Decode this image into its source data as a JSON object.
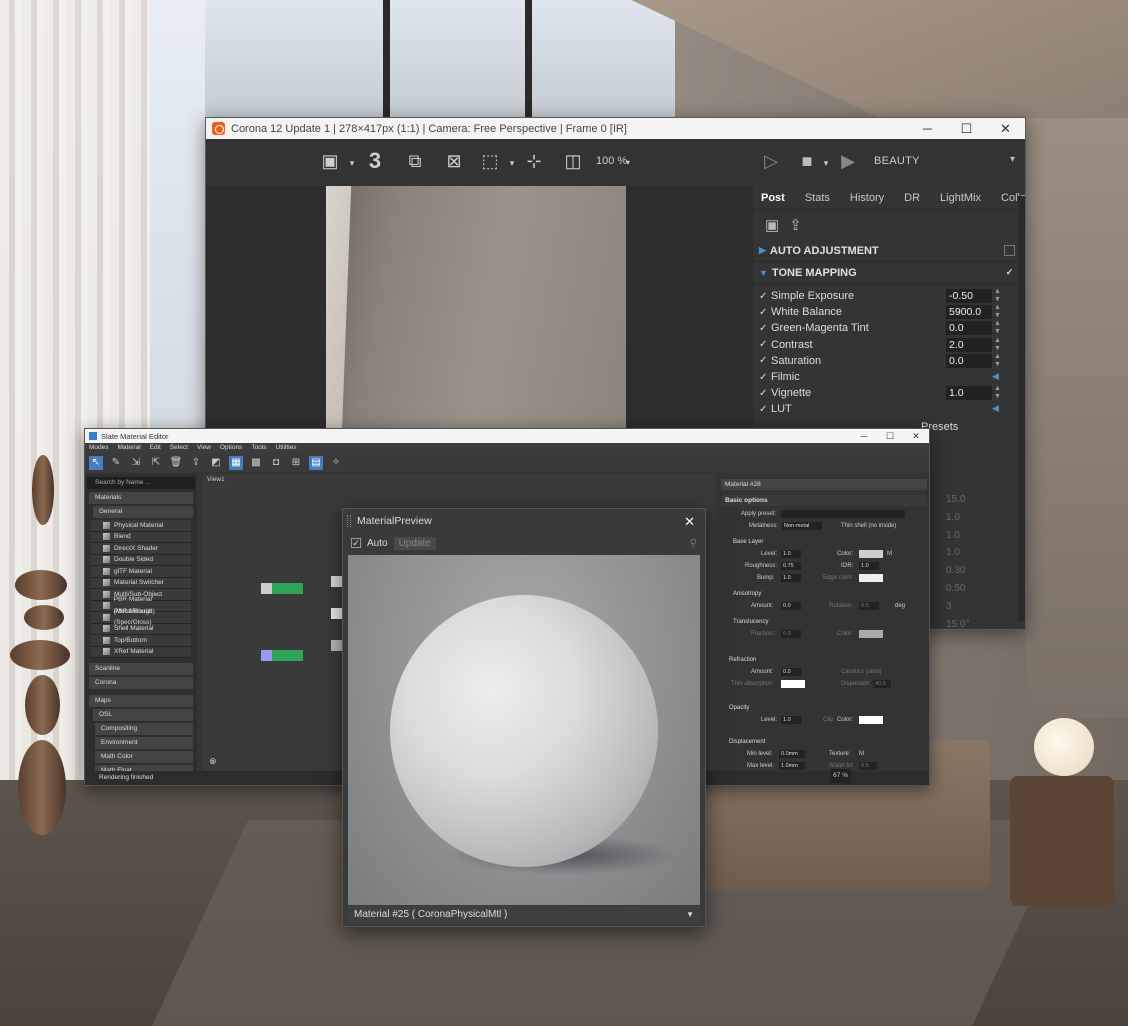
{
  "corona": {
    "title": "Corona 12 Update 1 | 278×417px (1:1) | Camera: Free Perspective | Frame 0 [IR]",
    "toolbar": {
      "frame_number": "3",
      "zoom": "100 %",
      "render_pass": "BEAUTY"
    },
    "tabs": [
      "Post",
      "Stats",
      "History",
      "DR",
      "LightMix",
      "Collab"
    ],
    "sections": {
      "auto_adjustment": "AUTO ADJUSTMENT",
      "tone_mapping": "TONE MAPPING"
    },
    "tone_mapping": [
      {
        "label": "Simple Exposure",
        "value": "-0.50"
      },
      {
        "label": "White Balance",
        "value": "5900.0"
      },
      {
        "label": "Green-Magenta Tint",
        "value": "0.0"
      },
      {
        "label": "Contrast",
        "value": "2.0"
      },
      {
        "label": "Saturation",
        "value": "0.0"
      },
      {
        "label": "Filmic",
        "value": ""
      },
      {
        "label": "Vignette",
        "value": "1.0"
      },
      {
        "label": "LUT",
        "value": ""
      }
    ],
    "presets_label": "Presets",
    "hidden_values": [
      "15.0",
      "1.0",
      "1.0",
      "1.0",
      "0.30",
      "0.50",
      "3",
      "15.0°"
    ]
  },
  "slate": {
    "title": "Slate Material Editor",
    "menu": [
      "Modes",
      "Material",
      "Edit",
      "Select",
      "View",
      "Options",
      "Tools",
      "Utilities"
    ],
    "search_placeholder": "Search by Name ...",
    "materials_group": "Materials",
    "general_group": "General",
    "materials": [
      "Physical Material",
      "Blend",
      "DirectX Shader",
      "Double Sided",
      "glTF Material",
      "Material Switcher",
      "Multi/Sub-Object",
      "PBR Material (Metal/Rough)",
      "PBR Material (Spec/Gloss)",
      "Shell Material",
      "Top/Bottom",
      "XRef Material"
    ],
    "groups": [
      "Scanline",
      "Corona"
    ],
    "maps_group": "Maps",
    "osl_group": "OSL",
    "map_groups": [
      "Compositing",
      "Environment",
      "Math Color",
      "Math Float"
    ],
    "view_label": "View1",
    "panel_title": "Material #28",
    "basic_options": "Basic options",
    "apply_preset": "Apply preset:",
    "metalness_label": "Metalness:",
    "metalness_value": "Non-metal",
    "thin_shell": "Thin shell (no inside)",
    "base_layer": "Base Layer",
    "level_label": "Level:",
    "level_value": "1.0",
    "color_label": "Color:",
    "roughness_label": "Roughness:",
    "roughness_value": "0.75",
    "ior_label": "IOR:",
    "ior_value": "1.0",
    "bump_label": "Bump:",
    "bump_value": "1.0",
    "edge_color_label": "Edge color:",
    "anisotropy": "Anisotropy",
    "amount_label": "Amount:",
    "amount_value": "0.0",
    "rotation_label": "Rotation:",
    "rotation_value": "0.0",
    "deg": "deg",
    "translucency": "Translucency",
    "fraction_label": "Fraction:",
    "fraction_value": "0.0",
    "refraction": "Refraction",
    "refr_amount": "0.0",
    "caustics": "Caustics (slow)",
    "thin_absorption": "Thin absorption:",
    "dispersion": "Dispersion",
    "dispersion_value": "40.0",
    "opacity": "Opacity",
    "opacity_level": "1.0",
    "clip": "Clip",
    "displacement": "Displacement",
    "min_level_label": "Min level:",
    "min_level_value": "0.0mm",
    "max_level_label": "Max level:",
    "max_level_value": "1.0mm",
    "texture_label": "Texture:",
    "water_lvl": "Water lvl:",
    "water_lvl_value": "0.5",
    "m_label": "M",
    "status": "Rendering finished",
    "zoom": "67 %"
  },
  "preview": {
    "title": "MaterialPreview",
    "auto_label": "Auto",
    "update_label": "Update",
    "material_name": "Material #25  ( CoronaPhysicalMtl )"
  }
}
